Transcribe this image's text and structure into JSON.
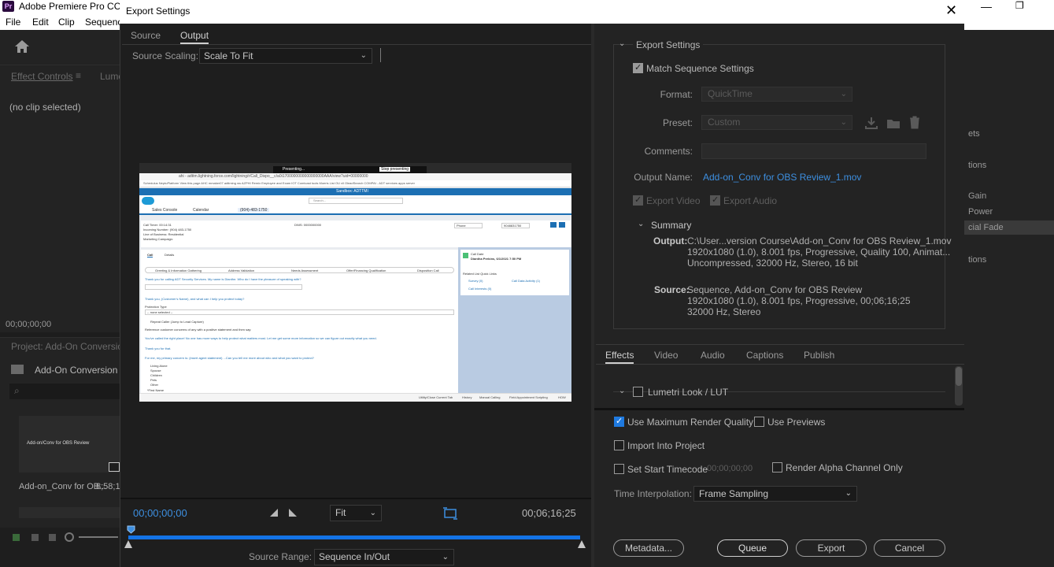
{
  "background_app": {
    "title": "Adobe Premiere Pro CC",
    "logo": "Pr",
    "menu": [
      "File",
      "Edit",
      "Clip",
      "Sequenc"
    ],
    "effect_controls_tab": "Effect Controls",
    "lumetri_tab": "Lume",
    "no_clip": "(no clip selected)",
    "timecode": "00;00;00;00",
    "project_title": "Project: Add-On Conversion",
    "project_name": "Add-On Conversion Co",
    "thumb_title": "Add-on/Conv for OBS Review",
    "thumb_label": "Add-on_Conv for OB...",
    "thumb_duration": "8;58;16",
    "right_items": [
      "ets",
      "tions",
      "Gain",
      "Power",
      "cial Fade",
      "tions"
    ]
  },
  "dialog": {
    "title": "Export Settings",
    "tabs": {
      "source": "Source",
      "output": "Output"
    },
    "source_scaling": {
      "label": "Source Scaling:",
      "value": "Scale To Fit"
    },
    "preview": {
      "browser_share_text": "Presenting...",
      "stop_presenting": "Stop presenting",
      "url": "ahi - adttm.lightning.force.com/lightning/r/Call_Dispo__c/a0i1700000000000000000AAA/view?uid=00000000",
      "bookmarks": "Schedulus   NeptuPlatform   View this page   AHC   mmaker07   adtiming ws   AZPHI   Remix   Employee and Exam   IOT   Comtcast tools   Moeris List   OU vll   OleadSearch   COMPAI - ADT   services apps   server",
      "sandbox": "Sandbox: ADTTMI",
      "search": "Search...",
      "app_name": "Sales Console",
      "app_tab1": "Calendar",
      "app_tab2": "(904)-483-1750",
      "call_timer": "Call Timer:  00:14:31",
      "incoming": "Incoming Number: (904) 483-1750",
      "line_of_business": "Line of Business: Residential",
      "marketing": "Marketing Campaign:",
      "dnis": "DNIS: 0000000000",
      "phone_select": "Phone",
      "phone_value": "9048831750",
      "call_tab": "Call",
      "details_tab": "Details",
      "path": [
        "Greeting & Information Gathering",
        "Address Validation",
        "Needs Assessment",
        "Offer/Financing Qualification",
        "Disposition Call"
      ],
      "script_line1": "Thank you for calling ADT Security Services. My name is Dianthe. Who do I have the pleasure of speaking with?",
      "script_line2": "Thank you, (Customer's Name), and what can I help you protect today?",
      "protection_type": "Protection Type",
      "none_selected": "-- none selected --",
      "repeat_caller": "Repeat Caller (Jump to Lead Capture)",
      "reference": "Reference customer concerns of any with a positive statement and then say:",
      "protect_line": "You've called the right place! No one has more ways to help protect what matters most. Let me get some more information so we can figure out exactly what you need.",
      "thank_you": "Thank you for that.",
      "primary_concern": "For me, my primary concern is: (insert agent statement) ...Can you tell me more about who and what you want to protect?",
      "options": [
        "Living Alone",
        "Spouse",
        "Children",
        "Pets",
        "Other"
      ],
      "first_name": "*First Name",
      "call_date_label": "Call Date",
      "call_date_value": "Diantha Perkins, 6/1/2021 7:50 PM",
      "related_links": "Related List Quick Links",
      "link1": "Survey (0)",
      "link2": "Call Data Activity (1)",
      "link3": "Call Interests (0)",
      "footer1": "Utility/Close Current Tab",
      "footer2": "History",
      "footer3": "Manual Calling",
      "footer4": "Field Appointment Scripting",
      "footer5": "HOW"
    },
    "transport": {
      "timecode_in": "00;00;00;00",
      "fit": "Fit",
      "timecode_out": "00;06;16;25",
      "source_range_label": "Source Range:",
      "source_range_value": "Sequence In/Out",
      "playhead_fraction": 0
    },
    "export_settings": {
      "header": "Export Settings",
      "match_sequence": "Match Sequence Settings",
      "format_label": "Format:",
      "format_value": "QuickTime",
      "preset_label": "Preset:",
      "preset_value": "Custom",
      "comments_label": "Comments:",
      "output_name_label": "Output Name:",
      "output_name_value": "Add-on_Conv for OBS Review_1.mov",
      "export_video": "Export Video",
      "export_audio": "Export Audio"
    },
    "summary": {
      "header": "Summary",
      "output_key": "Output:",
      "output_lines": [
        "C:\\User...version Course\\Add-on_Conv for OBS Review_1.mov",
        "1920x1080 (1.0), 8.001 fps, Progressive, Quality 100, Animat...",
        "Uncompressed, 32000 Hz, Stereo, 16 bit"
      ],
      "source_key": "Source:",
      "source_lines": [
        "Sequence, Add-on_Conv for OBS Review",
        "1920x1080 (1.0), 8.001 fps, Progressive, 00;06;16;25",
        "32000 Hz, Stereo"
      ]
    },
    "effects_tabs": [
      "Effects",
      "Video",
      "Audio",
      "Captions",
      "Publish"
    ],
    "lumetri": "Lumetri Look / LUT",
    "options": {
      "use_max_render": "Use Maximum Render Quality",
      "use_previews": "Use Previews",
      "import_into_project": "Import Into Project",
      "set_start_timecode": "Set Start Timecode",
      "start_timecode_value": "00;00;00;00",
      "render_alpha": "Render Alpha Channel Only",
      "time_interp_label": "Time Interpolation:",
      "time_interp_value": "Frame Sampling"
    },
    "buttons": {
      "metadata": "Metadata...",
      "queue": "Queue",
      "export": "Export",
      "cancel": "Cancel"
    }
  }
}
